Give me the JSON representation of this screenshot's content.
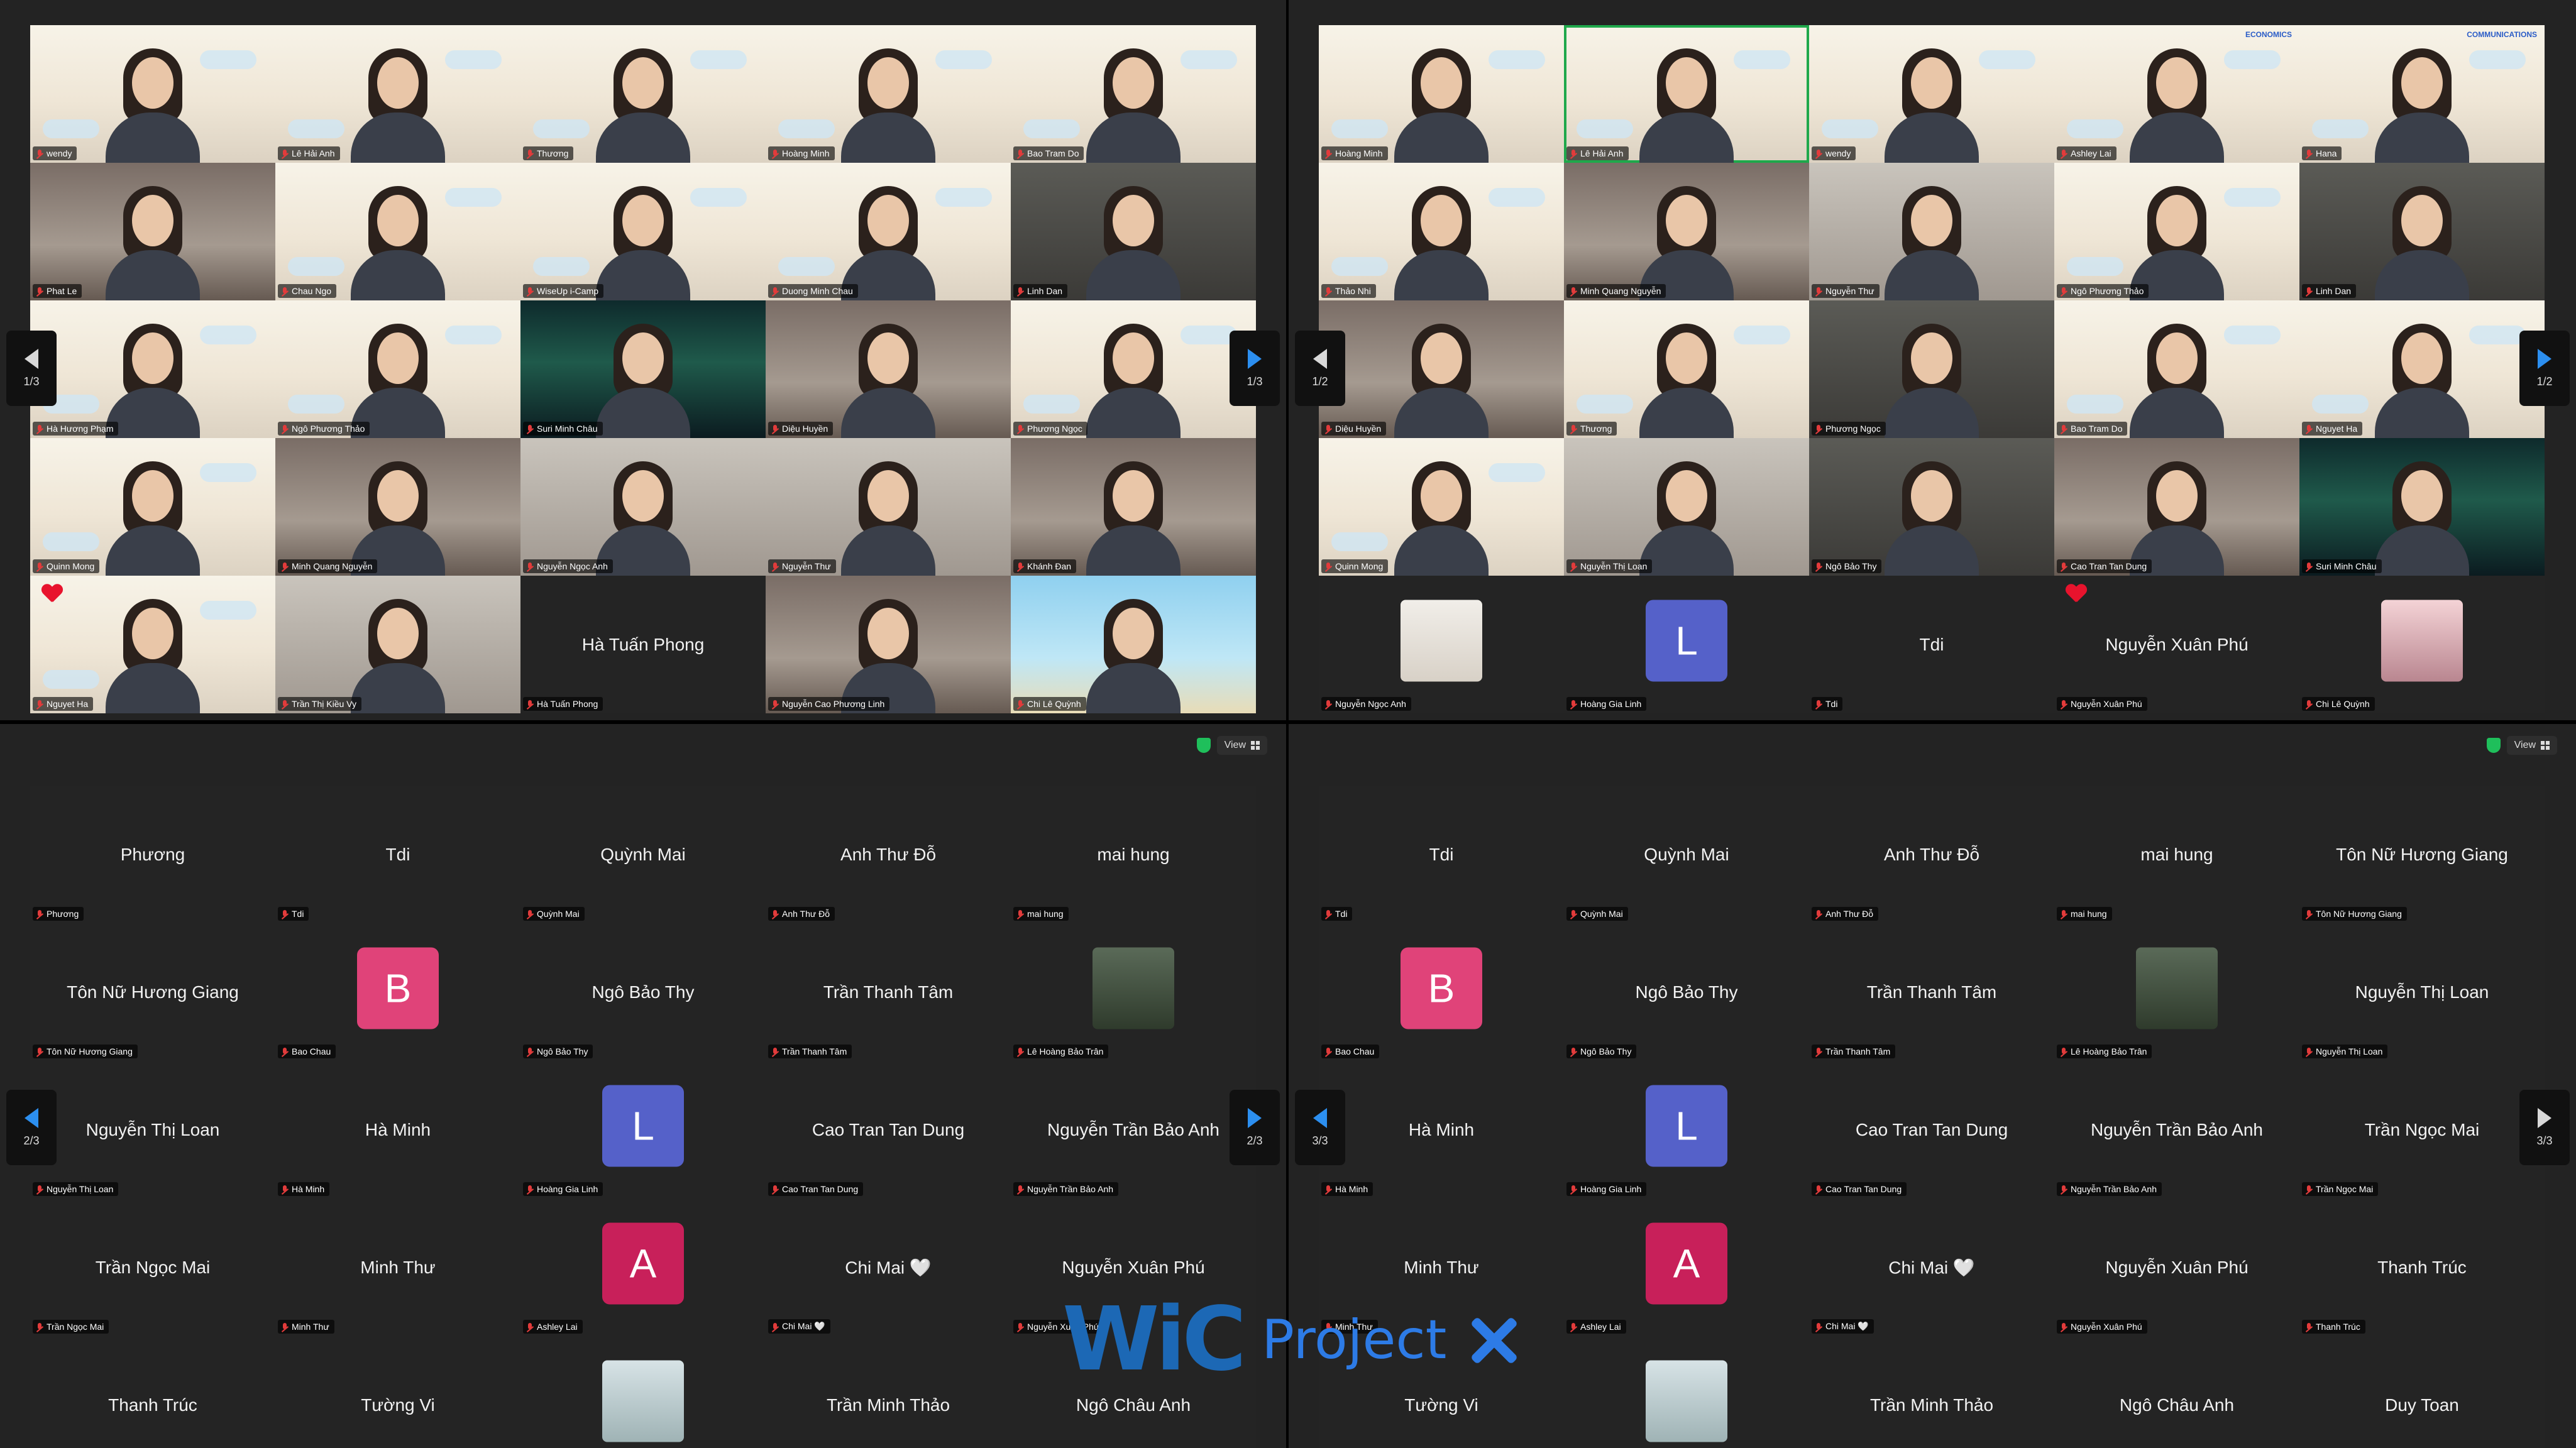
{
  "panels": [
    {
      "id": "top-left",
      "show_topbar": false,
      "page_label": "1/3",
      "left_arrow_active": false,
      "tiles": [
        {
          "type": "video",
          "name": "wendy"
        },
        {
          "type": "video",
          "name": "Lê Hải Anh"
        },
        {
          "type": "video",
          "name": "Thương"
        },
        {
          "type": "video",
          "name": "Hoàng Minh"
        },
        {
          "type": "video",
          "name": "Bao Tram Do"
        },
        {
          "type": "video",
          "name": "Phat Le",
          "style": "room"
        },
        {
          "type": "video",
          "name": "Chau Ngo"
        },
        {
          "type": "video",
          "name": "WiseUp i-Camp"
        },
        {
          "type": "video",
          "name": "Duong Minh Chau"
        },
        {
          "type": "video",
          "name": "Linh Dan",
          "style": "dark"
        },
        {
          "type": "video",
          "name": "Hà Hương Phạm"
        },
        {
          "type": "video",
          "name": "Ngô Phương Thảo"
        },
        {
          "type": "video",
          "name": "Suri Minh Châu",
          "style": "aurora"
        },
        {
          "type": "video",
          "name": "Diệu Huyền",
          "style": "room"
        },
        {
          "type": "video",
          "name": "Phương Ngọc"
        },
        {
          "type": "video",
          "name": "Quinn Mong"
        },
        {
          "type": "video",
          "name": "Minh Quang Nguyễn",
          "style": "room"
        },
        {
          "type": "video",
          "name": "Nguyễn Ngọc Anh",
          "style": "blur"
        },
        {
          "type": "video",
          "name": "Nguyễn Thư",
          "style": "blur"
        },
        {
          "type": "video",
          "name": "Khánh Đan",
          "style": "room"
        },
        {
          "type": "video",
          "name": "Nguyet Ha",
          "heart": true
        },
        {
          "type": "video",
          "name": "Trần Thị Kiều Vy",
          "style": "blur"
        },
        {
          "type": "name",
          "name": "Hà Tuấn Phong",
          "display": "Hà Tuấn Phong"
        },
        {
          "type": "video",
          "name": "Nguyễn Cao Phương Linh",
          "style": "room"
        },
        {
          "type": "video",
          "name": "Chi Lê Quỳnh",
          "style": "beach"
        }
      ]
    },
    {
      "id": "top-right",
      "show_topbar": false,
      "page_label": "1/2",
      "left_arrow_active": false,
      "tiles": [
        {
          "type": "video",
          "name": "Hoàng Minh"
        },
        {
          "type": "video",
          "name": "Lê Hải Anh",
          "active": true
        },
        {
          "type": "video",
          "name": "wendy"
        },
        {
          "type": "video",
          "name": "Ashley Lai",
          "brand": "ECONOMICS"
        },
        {
          "type": "video",
          "name": "Hana",
          "brand": "COMMUNICATIONS"
        },
        {
          "type": "video",
          "name": "Thảo Nhi"
        },
        {
          "type": "video",
          "name": "Minh Quang Nguyễn",
          "style": "room"
        },
        {
          "type": "video",
          "name": "Nguyễn Thư",
          "style": "blur"
        },
        {
          "type": "video",
          "name": "Ngô Phương Thảo"
        },
        {
          "type": "video",
          "name": "Linh Dan",
          "style": "dark"
        },
        {
          "type": "video",
          "name": "Diệu Huyền",
          "style": "room"
        },
        {
          "type": "video",
          "name": "Thương"
        },
        {
          "type": "video",
          "name": "Phương Ngọc",
          "style": "dark"
        },
        {
          "type": "video",
          "name": "Bao Tram Do"
        },
        {
          "type": "video",
          "name": "Nguyet Ha"
        },
        {
          "type": "video",
          "name": "Quinn Mong"
        },
        {
          "type": "video",
          "name": "Nguyễn Thị Loan",
          "style": "blur"
        },
        {
          "type": "video",
          "name": "Ngô Bảo Thy",
          "style": "dark"
        },
        {
          "type": "video",
          "name": "Cao Tran Tan Dung",
          "style": "room"
        },
        {
          "type": "video",
          "name": "Suri Minh Châu",
          "style": "aurora"
        },
        {
          "type": "photo",
          "name": "Nguyễn Ngọc Anh",
          "photo": "light"
        },
        {
          "type": "avatar",
          "name": "Hoàng Gia Linh",
          "letter": "L",
          "color": "#5561c9"
        },
        {
          "type": "name",
          "name": "Tdi",
          "display": "Tdi"
        },
        {
          "type": "name",
          "name": "Nguyễn Xuân Phú",
          "display": "Nguyễn Xuân Phú",
          "heart": true
        },
        {
          "type": "photo",
          "name": "Chi Lê Quỳnh",
          "photo": "pink"
        }
      ]
    },
    {
      "id": "bottom-left",
      "show_topbar": true,
      "view_label": "View",
      "page_label": "2/3",
      "left_arrow_active": true,
      "tiles": [
        {
          "type": "name",
          "name": "Phương",
          "display": "Phương"
        },
        {
          "type": "name",
          "name": "Tdi",
          "display": "Tdi"
        },
        {
          "type": "name",
          "name": "Quỳnh Mai",
          "display": "Quỳnh Mai"
        },
        {
          "type": "name",
          "name": "Anh Thư Đỗ",
          "display": "Anh Thư Đỗ"
        },
        {
          "type": "name",
          "name": "mai hung",
          "display": "mai hung"
        },
        {
          "type": "name",
          "name": "Tôn Nữ Hương Giang",
          "display": "Tôn Nữ Hương Giang"
        },
        {
          "type": "avatar",
          "name": "Bao Chau",
          "letter": "B",
          "color": "#e04379"
        },
        {
          "type": "name",
          "name": "Ngô Bảo Thy",
          "display": "Ngô Bảo Thy"
        },
        {
          "type": "name",
          "name": "Trần Thanh Tâm",
          "display": "Trần Thanh Tâm"
        },
        {
          "type": "photo",
          "name": "Lê Hoàng Bảo Trân",
          "photo": "dark"
        },
        {
          "type": "name",
          "name": "Nguyễn Thị Loan",
          "display": "Nguyễn Thị Loan"
        },
        {
          "type": "name",
          "name": "Hà Minh",
          "display": "Hà Minh"
        },
        {
          "type": "avatar",
          "name": "Hoàng Gia Linh",
          "letter": "L",
          "color": "#5561c9"
        },
        {
          "type": "name",
          "name": "Cao Tran Tan Dung",
          "display": "Cao Tran Tan Dung"
        },
        {
          "type": "name",
          "name": "Nguyễn Trần Bảo Anh",
          "display": "Nguyễn Trần Bảo Anh"
        },
        {
          "type": "name",
          "name": "Trần Ngọc Mai",
          "display": "Trần Ngọc Mai"
        },
        {
          "type": "name",
          "name": "Minh Thư",
          "display": "Minh Thư"
        },
        {
          "type": "avatar",
          "name": "Ashley Lai",
          "letter": "A",
          "color": "#c8205a"
        },
        {
          "type": "name",
          "name": "Chi Mai 🤍",
          "display": "Chi Mai 🤍"
        },
        {
          "type": "name",
          "name": "Nguyễn Xuân Phú",
          "display": "Nguyễn Xuân Phú"
        },
        {
          "type": "name",
          "name": "",
          "display": "Thanh Trúc"
        },
        {
          "type": "name",
          "name": "",
          "display": "Tường Vi"
        },
        {
          "type": "photo",
          "name": "",
          "photo": "window"
        },
        {
          "type": "name",
          "name": "",
          "display": "Trần Minh Thảo"
        },
        {
          "type": "name",
          "name": "",
          "display": "Ngô Châu Anh"
        }
      ]
    },
    {
      "id": "bottom-right",
      "show_topbar": true,
      "view_label": "View",
      "page_label": "3/3",
      "left_arrow_active": true,
      "right_arrow_gray": true,
      "tiles": [
        {
          "type": "name",
          "name": "Tdi",
          "display": "Tdi"
        },
        {
          "type": "name",
          "name": "Quỳnh Mai",
          "display": "Quỳnh Mai"
        },
        {
          "type": "name",
          "name": "Anh Thư Đỗ",
          "display": "Anh Thư Đỗ"
        },
        {
          "type": "name",
          "name": "mai hung",
          "display": "mai hung"
        },
        {
          "type": "name",
          "name": "Tôn Nữ Hương Giang",
          "display": "Tôn Nữ Hương Giang"
        },
        {
          "type": "avatar",
          "name": "Bao Chau",
          "letter": "B",
          "color": "#e04379"
        },
        {
          "type": "name",
          "name": "Ngô Bảo Thy",
          "display": "Ngô Bảo Thy"
        },
        {
          "type": "name",
          "name": "Trần Thanh Tâm",
          "display": "Trần Thanh Tâm"
        },
        {
          "type": "photo",
          "name": "Lê Hoàng Bảo Trân",
          "photo": "dark"
        },
        {
          "type": "name",
          "name": "Nguyễn Thị Loan",
          "display": "Nguyễn Thị Loan"
        },
        {
          "type": "name",
          "name": "Hà Minh",
          "display": "Hà Minh"
        },
        {
          "type": "avatar",
          "name": "Hoàng Gia Linh",
          "letter": "L",
          "color": "#5561c9"
        },
        {
          "type": "name",
          "name": "Cao Tran Tan Dung",
          "display": "Cao Tran Tan Dung"
        },
        {
          "type": "name",
          "name": "Nguyễn Trần Bảo Anh",
          "display": "Nguyễn Trần Bảo Anh"
        },
        {
          "type": "name",
          "name": "Trần Ngọc Mai",
          "display": "Trần Ngọc Mai"
        },
        {
          "type": "name",
          "name": "Minh Thư",
          "display": "Minh Thư"
        },
        {
          "type": "avatar",
          "name": "Ashley Lai",
          "letter": "A",
          "color": "#c8205a"
        },
        {
          "type": "name",
          "name": "Chi Mai 🤍",
          "display": "Chi Mai 🤍"
        },
        {
          "type": "name",
          "name": "Nguyễn Xuân Phú",
          "display": "Nguyễn Xuân Phú"
        },
        {
          "type": "name",
          "name": "Thanh Trúc",
          "display": "Thanh Trúc"
        },
        {
          "type": "name",
          "name": "",
          "display": "Tường Vi"
        },
        {
          "type": "photo",
          "name": "",
          "photo": "window"
        },
        {
          "type": "name",
          "name": "",
          "display": "Trần Minh Thảo"
        },
        {
          "type": "name",
          "name": "",
          "display": "Ngô Châu Anh"
        },
        {
          "type": "name",
          "name": "",
          "display": "Duy Toan"
        }
      ]
    }
  ],
  "watermark": {
    "wic": "WiC",
    "project": "Project"
  },
  "colors": {
    "accent": "#2c8ff0",
    "active_speaker": "#1fa84b",
    "muted": "#e23b3b"
  }
}
